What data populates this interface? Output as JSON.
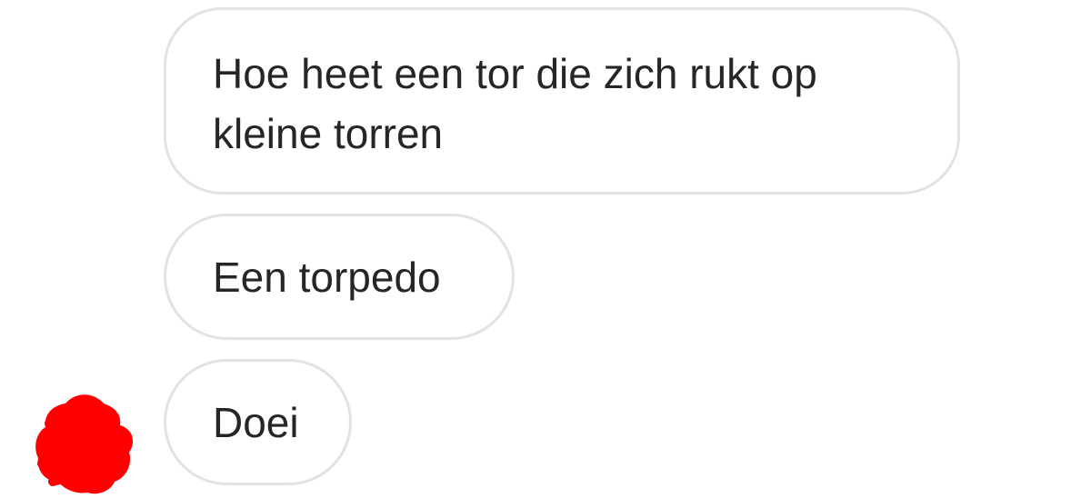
{
  "conversation": {
    "messages": [
      {
        "text": "Hoe heet een tor die zich rukt op\nkleine torren"
      },
      {
        "text": "Een torpedo"
      },
      {
        "text": "Doei"
      }
    ],
    "avatar": {
      "redaction_color": "#ff0000"
    }
  }
}
